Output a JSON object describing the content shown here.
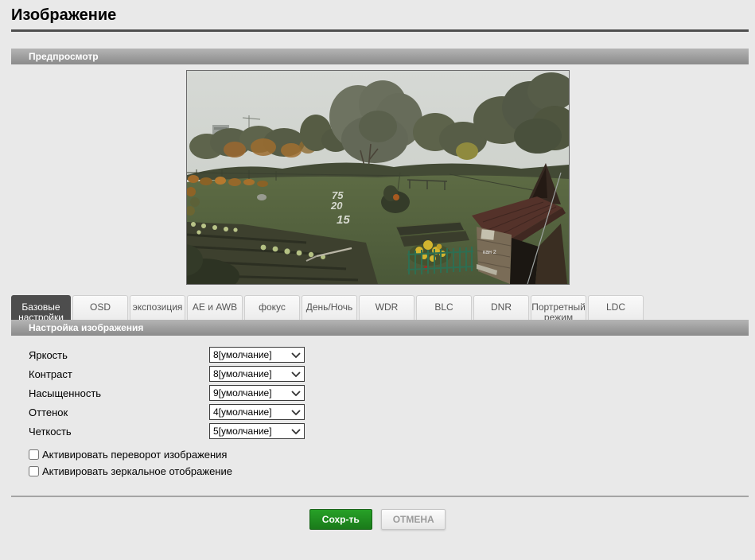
{
  "page": {
    "title": "Изображение"
  },
  "preview": {
    "header": "Предпросмотр",
    "markers": [
      "75",
      "20",
      "15"
    ],
    "osd_channel": "кан 2"
  },
  "tabs": [
    {
      "label": "Базовые настройки",
      "active": true
    },
    {
      "label": "OSD",
      "active": false
    },
    {
      "label": "экспозиция",
      "active": false
    },
    {
      "label": "AE и AWB",
      "active": false
    },
    {
      "label": "фокус",
      "active": false
    },
    {
      "label": "День/Ночь",
      "active": false
    },
    {
      "label": "WDR",
      "active": false
    },
    {
      "label": "BLC",
      "active": false
    },
    {
      "label": "DNR",
      "active": false
    },
    {
      "label": "Портретный режим",
      "active": false
    },
    {
      "label": "LDC",
      "active": false
    }
  ],
  "settings": {
    "header": "Настройка изображения",
    "fields": [
      {
        "label": "Яркость",
        "value": "8[умолчание]"
      },
      {
        "label": "Контраст",
        "value": "8[умолчание]"
      },
      {
        "label": "Насыщенность",
        "value": "9[умолчание]"
      },
      {
        "label": "Оттенок",
        "value": "4[умолчание]"
      },
      {
        "label": "Четкость",
        "value": "5[умолчание]"
      }
    ],
    "checkboxes": [
      {
        "label": "Активировать переворот изображения",
        "checked": false
      },
      {
        "label": "Активировать зеркальное отображение",
        "checked": false
      }
    ]
  },
  "actions": {
    "save": "Сохр-ть",
    "cancel": "ОТМЕНА"
  },
  "colors": {
    "save_green": "#1e8a1e",
    "section_bar_gray": "#9b9b9b",
    "active_tab": "#4d4d4d",
    "page_bg": "#e9e9e9"
  }
}
